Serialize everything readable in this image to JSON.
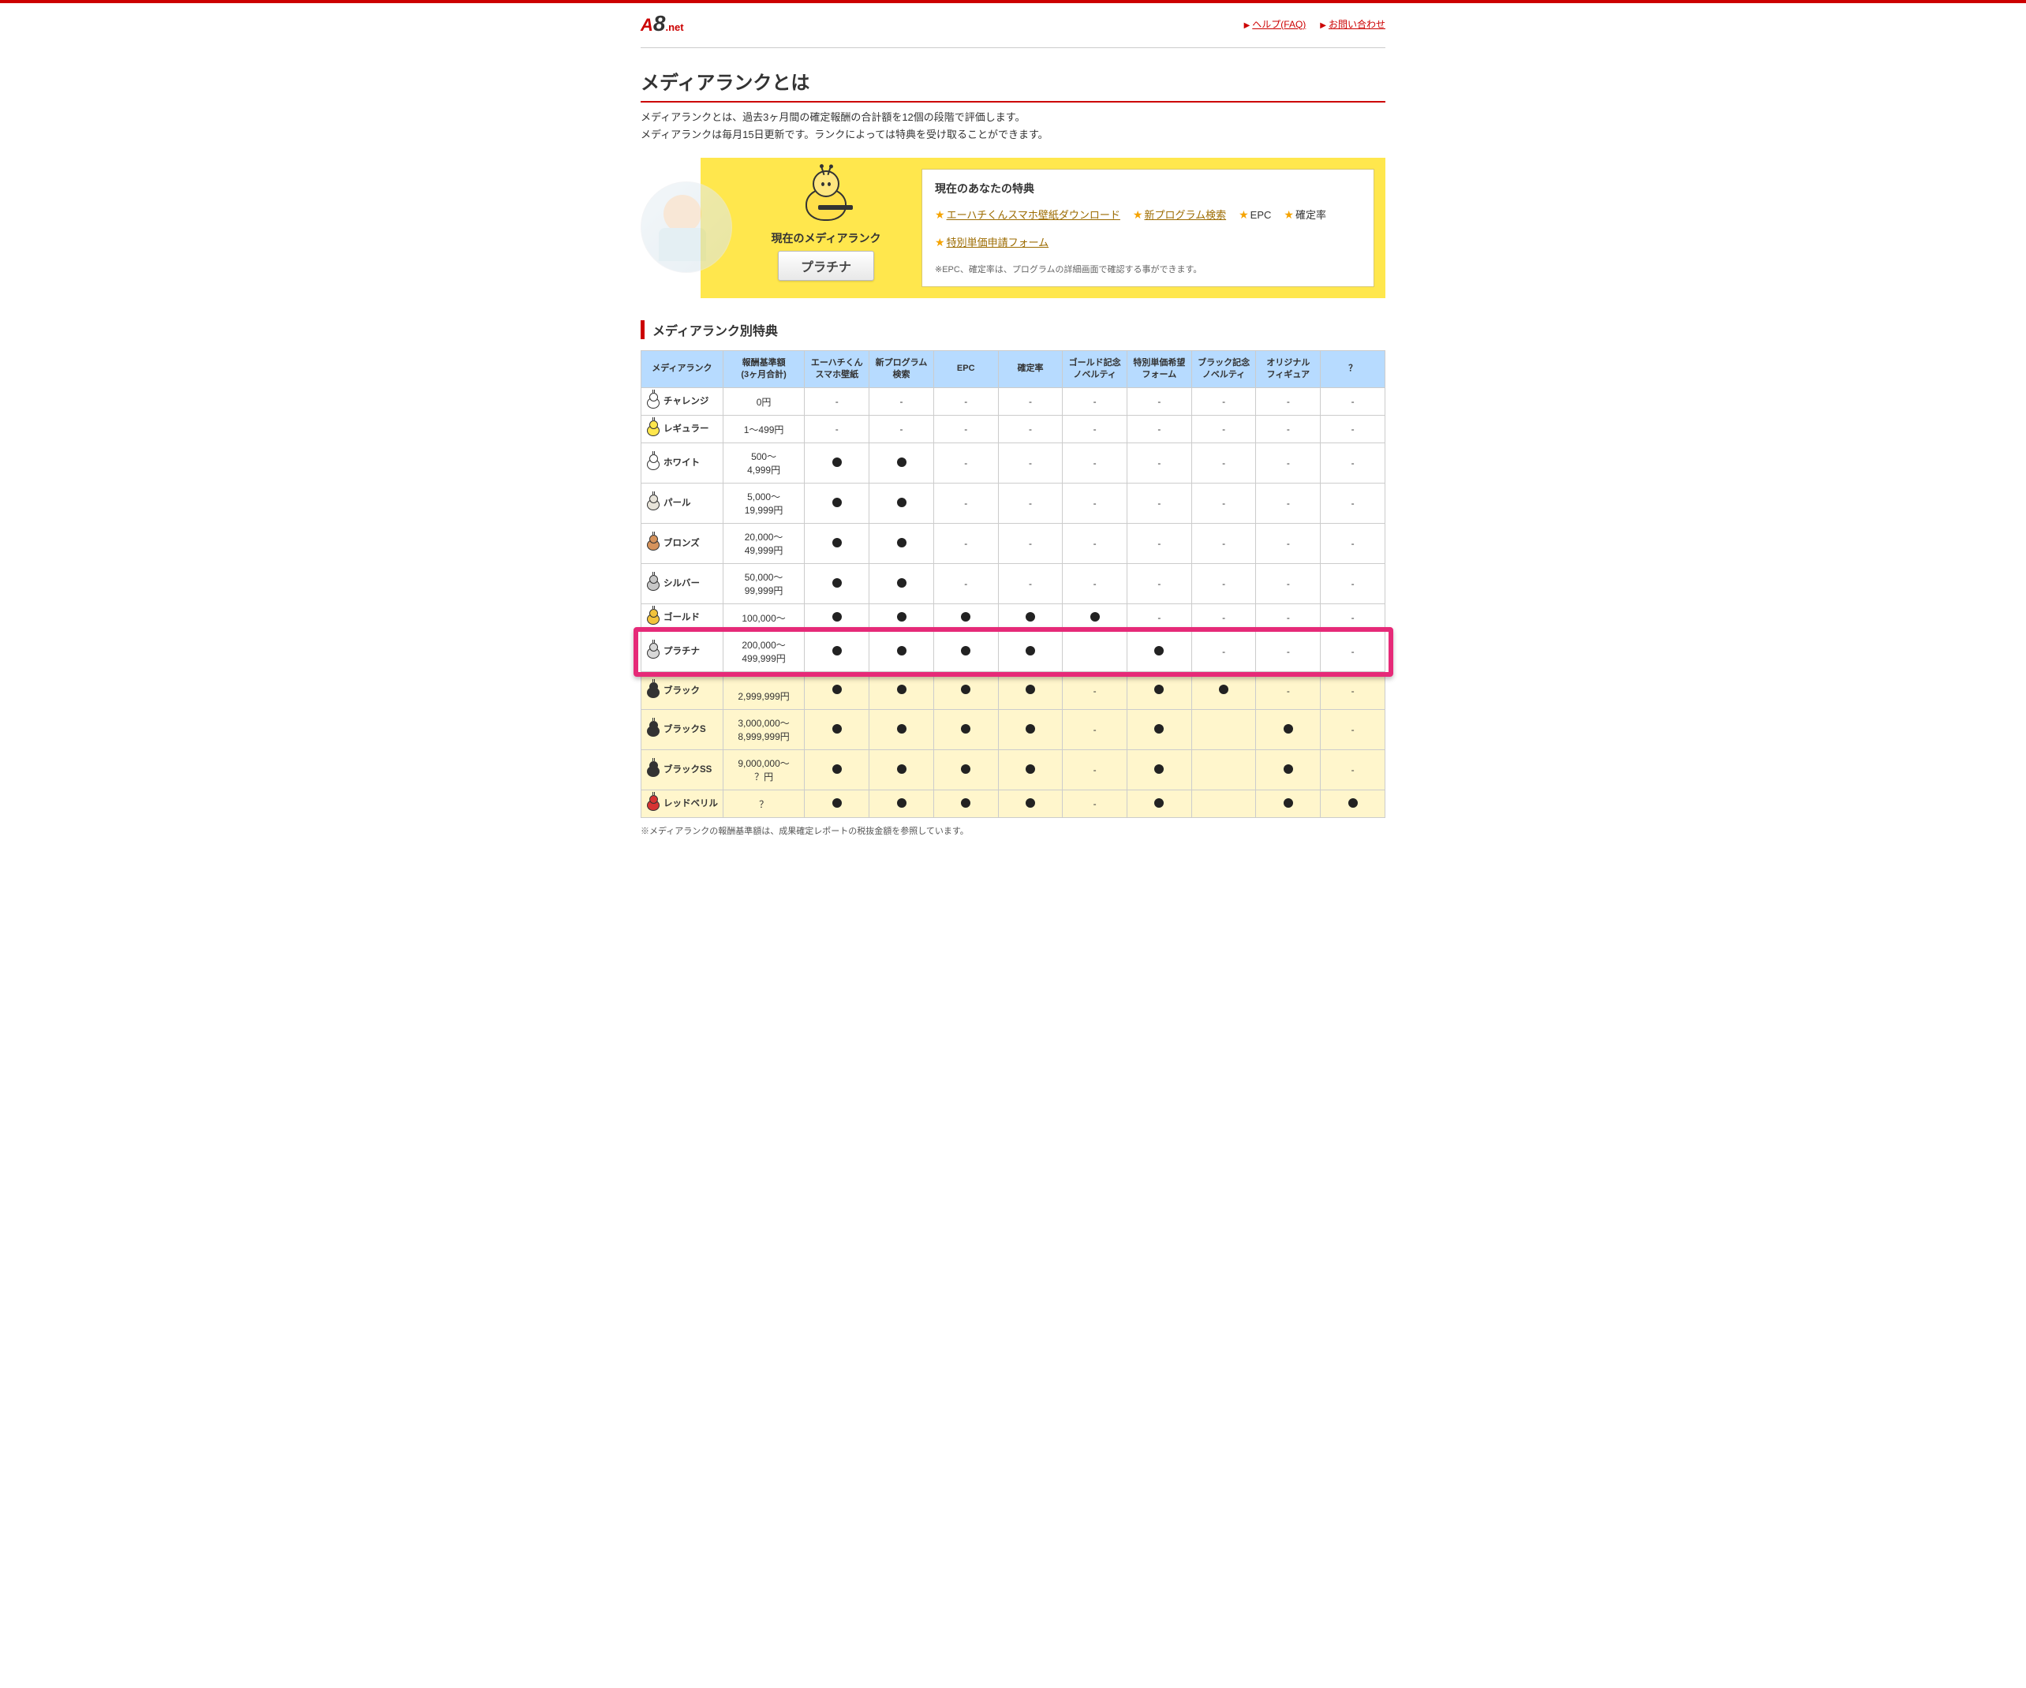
{
  "header": {
    "logo": {
      "a": "A",
      "eight": "8",
      "net": ".net"
    },
    "links": {
      "help": "ヘルプ(FAQ)",
      "contact": "お問い合わせ"
    }
  },
  "page_title": "メディアランクとは",
  "intro_line1": "メディアランクとは、過去3ヶ月間の確定報酬の合計額を12個の段階で評価します。",
  "intro_line2": "メディアランクは毎月15日更新です。ランクによっては特典を受け取ることができます。",
  "current": {
    "caption": "現在のメディアランク",
    "rank": "プラチナ",
    "benefits_title": "現在のあなたの特典",
    "items": {
      "wallpaper": "エーハチくんスマホ壁紙ダウンロード",
      "newprog": "新プログラム検索",
      "epc": "EPC",
      "rate": "確定率",
      "special": "特別単価申請フォーム"
    },
    "note": "※EPC、確定率は、プログラムの詳細画面で確認する事ができます。"
  },
  "section_title": "メディアランク別特典",
  "columns": [
    "メディアランク",
    "報酬基準額\n(3ヶ月合計)",
    "エーハチくん\nスマホ壁紙",
    "新プログラム\n検索",
    "EPC",
    "確定率",
    "ゴールド記念\nノベルティ",
    "特別単価希望\nフォーム",
    "ブラック記念\nノベルティ",
    "オリジナル\nフィギュア",
    "？"
  ],
  "ranks": [
    {
      "name": "チャレンジ",
      "color": "#fff",
      "amount": "0円",
      "cells": [
        "-",
        "-",
        "-",
        "-",
        "-",
        "-",
        "-",
        "-",
        "-"
      ]
    },
    {
      "name": "レギュラー",
      "color": "#ffe74d",
      "amount": "1〜499円",
      "cells": [
        "-",
        "-",
        "-",
        "-",
        "-",
        "-",
        "-",
        "-",
        "-"
      ]
    },
    {
      "name": "ホワイト",
      "color": "#fff",
      "amount": "500〜\n4,999円",
      "cells": [
        "●",
        "●",
        "-",
        "-",
        "-",
        "-",
        "-",
        "-",
        "-"
      ]
    },
    {
      "name": "パール",
      "color": "#e8e4da",
      "amount": "5,000〜\n19,999円",
      "cells": [
        "●",
        "●",
        "-",
        "-",
        "-",
        "-",
        "-",
        "-",
        "-"
      ]
    },
    {
      "name": "ブロンズ",
      "color": "#d6935c",
      "amount": "20,000〜\n49,999円",
      "cells": [
        "●",
        "●",
        "-",
        "-",
        "-",
        "-",
        "-",
        "-",
        "-"
      ]
    },
    {
      "name": "シルバー",
      "color": "#c7c7c7",
      "amount": "50,000〜\n99,999円",
      "cells": [
        "●",
        "●",
        "-",
        "-",
        "-",
        "-",
        "-",
        "-",
        "-"
      ]
    },
    {
      "name": "ゴールド",
      "color": "#f2c33c",
      "amount": "100,000〜",
      "cells": [
        "●",
        "●",
        "●",
        "●",
        "●",
        "-",
        "-",
        "-",
        "-"
      ],
      "hl": false
    },
    {
      "name": "プラチナ",
      "color": "#d8d8d8",
      "amount": "200,000〜\n499,999円",
      "cells": [
        "●",
        "●",
        "●",
        "●",
        "",
        "●",
        "-",
        "-",
        "-"
      ],
      "highlight": true
    },
    {
      "name": "ブラック",
      "color": "#333",
      "amount": "\n2,999,999円",
      "cells": [
        "●",
        "●",
        "●",
        "●",
        "-",
        "●",
        "●",
        "-",
        "-"
      ],
      "hl": true
    },
    {
      "name": "ブラックS",
      "color": "#333",
      "amount": "3,000,000〜\n8,999,999円",
      "cells": [
        "●",
        "●",
        "●",
        "●",
        "-",
        "●",
        "",
        "●",
        "-"
      ],
      "hl": true
    },
    {
      "name": "ブラックSS",
      "color": "#333",
      "amount": "9,000,000〜\n？円",
      "cells": [
        "●",
        "●",
        "●",
        "●",
        "-",
        "●",
        "",
        "●",
        "-"
      ],
      "hl": true
    },
    {
      "name": "レッドベリル",
      "color": "#d63333",
      "amount": "？",
      "cells": [
        "●",
        "●",
        "●",
        "●",
        "-",
        "●",
        "",
        "●",
        "●"
      ],
      "hl": true
    }
  ],
  "footnote": "※メディアランクの報酬基準額は、成果確定レポートの税抜金額を参照しています。"
}
